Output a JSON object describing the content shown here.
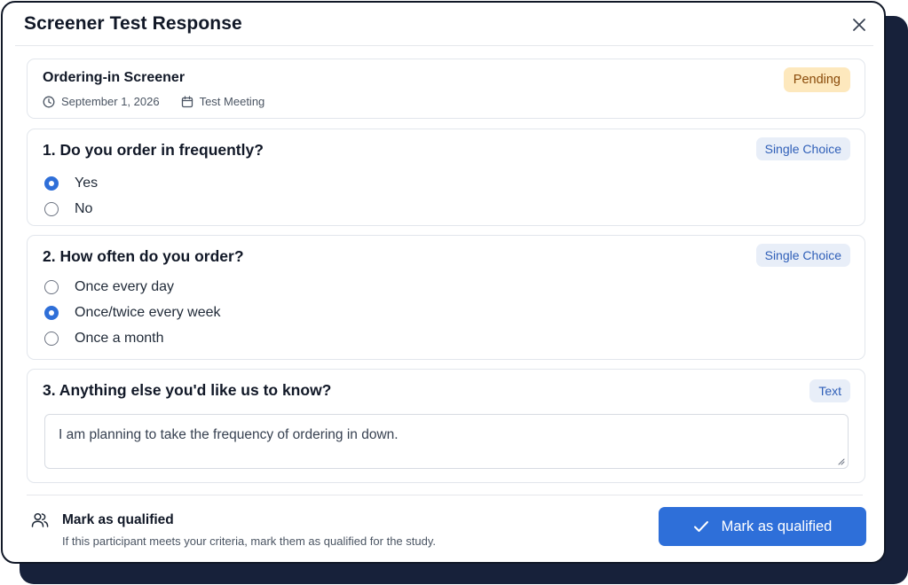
{
  "modal": {
    "title": "Screener Test Response"
  },
  "screener": {
    "title": "Ordering-in Screener",
    "date": "September 1, 2026",
    "meeting": "Test Meeting",
    "status": "Pending"
  },
  "questions": [
    {
      "title": "1. Do you order in frequently?",
      "type": "Single Choice",
      "options": [
        {
          "label": "Yes",
          "selected": true
        },
        {
          "label": "No",
          "selected": false
        }
      ]
    },
    {
      "title": "2. How often do you order?",
      "type": "Single Choice",
      "options": [
        {
          "label": "Once every day",
          "selected": false
        },
        {
          "label": "Once/twice every week",
          "selected": true
        },
        {
          "label": "Once a month",
          "selected": false
        }
      ]
    },
    {
      "title": "3. Anything else you'd like us to know?",
      "type": "Text",
      "answer": "I am planning to take the frequency of ordering in down."
    }
  ],
  "footer": {
    "title": "Mark as qualified",
    "subtitle": "If this participant meets your criteria, mark them as qualified for the study.",
    "button_label": "Mark as qualified"
  },
  "icons": {
    "close": "close-icon",
    "date": "clock-icon",
    "meeting": "calendar-icon",
    "users": "users-icon",
    "check": "check-icon"
  },
  "colors": {
    "accent": "#2e6fd9",
    "pending_bg": "#fde8bd",
    "pending_text": "#8a4b0a",
    "type_bg": "#e8eef8",
    "type_text": "#2f5fb8"
  }
}
